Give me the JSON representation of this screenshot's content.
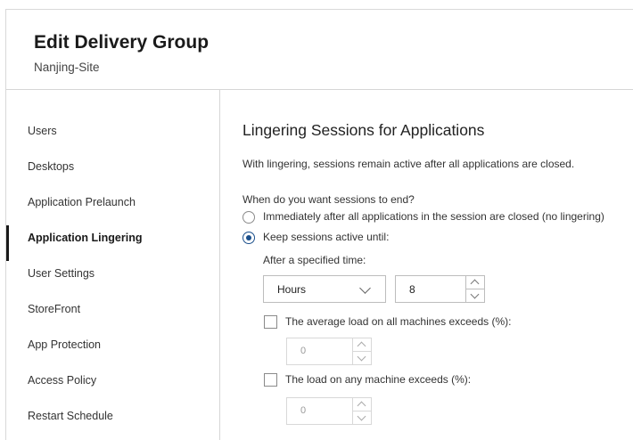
{
  "header": {
    "title": "Edit Delivery Group",
    "subtitle": "Nanjing-Site"
  },
  "sidebar": {
    "items": [
      {
        "label": "Users",
        "active": false
      },
      {
        "label": "Desktops",
        "active": false
      },
      {
        "label": "Application Prelaunch",
        "active": false
      },
      {
        "label": "Application Lingering",
        "active": true
      },
      {
        "label": "User Settings",
        "active": false
      },
      {
        "label": "StoreFront",
        "active": false
      },
      {
        "label": "App Protection",
        "active": false
      },
      {
        "label": "Access Policy",
        "active": false
      },
      {
        "label": "Restart Schedule",
        "active": false
      }
    ]
  },
  "main": {
    "section_title": "Lingering Sessions for Applications",
    "description": "With lingering, sessions remain active after all applications are closed.",
    "question": "When do you want sessions to end?",
    "options": [
      {
        "label": "Immediately after all applications in the session are closed (no lingering)",
        "selected": false
      },
      {
        "label": "Keep sessions active until:",
        "selected": true
      }
    ],
    "time": {
      "label": "After a specified time:",
      "unit": "Hours",
      "value": "8"
    },
    "average_load": {
      "label": "The average load on all machines exceeds (%):",
      "checked": false,
      "value": "0"
    },
    "machine_load": {
      "label": "The load on any machine exceeds (%):",
      "checked": false,
      "value": "0"
    }
  },
  "colors": {
    "accent": "#1a4f8b",
    "divider": "#d6d6d6"
  }
}
